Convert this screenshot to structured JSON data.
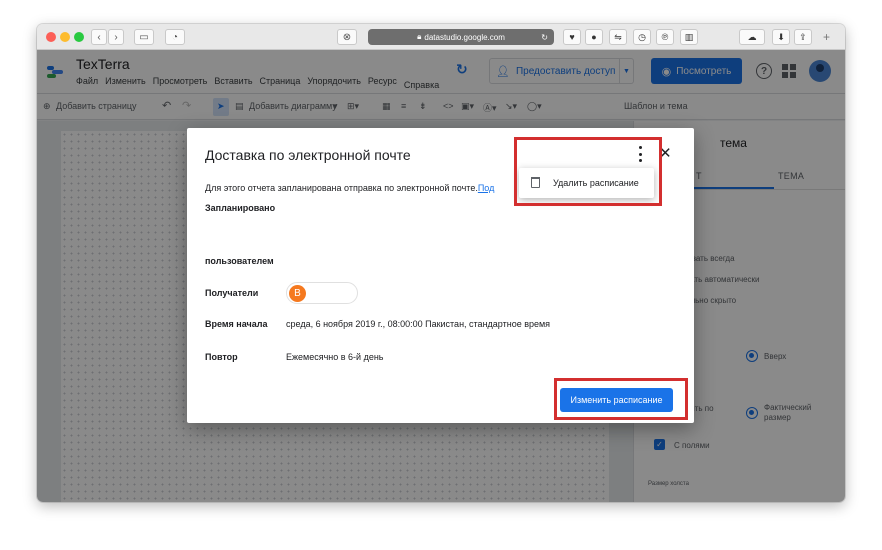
{
  "browser": {
    "url": "datastudio.google.com"
  },
  "app": {
    "title": "TexTerra",
    "menu": [
      "Файл",
      "Изменить",
      "Просмотреть",
      "Вставить",
      "Страница",
      "Упорядочить",
      "Ресурс",
      "Справка"
    ],
    "share_label": "Предоставить доступ",
    "view_label": "Посмотреть"
  },
  "toolbar": {
    "add_page": "Добавить страницу",
    "add_chart": "Добавить диаграмму",
    "template_theme": "Шаблон и тема"
  },
  "panel": {
    "title": "тема",
    "tab_data": "Т",
    "tab_theme": "ТЕМА",
    "items": {
      "always_show": "ывать всегда",
      "auto_show": "вать автоматически",
      "hidden": "ально скрыто",
      "top": "Вверх",
      "fit_a": "нять по",
      "fit_b": "е",
      "actual_size_a": "Фактический",
      "actual_size_b": "размер",
      "with_margins": "С полями",
      "canvas_size": "Размер холста"
    }
  },
  "dialog": {
    "title": "Доставка по электронной почте",
    "description": "Для этого отчета запланирована отправка по электронной почте.",
    "description_link": "Под",
    "scheduled_label": "Запланировано",
    "by_user_label": "пользователем",
    "recipients_label": "Получатели",
    "recipient_initial": "В",
    "start_time_label": "Время начала",
    "start_time_value": "среда, 6 ноября 2019 г., 08:00:00 Пакистан, стандартное время",
    "repeat_label": "Повтор",
    "repeat_value": "Ежемесячно в 6-й день",
    "edit_button": "Изменить расписание",
    "menu_delete": "Удалить расписание",
    "close_glyph": "✕"
  },
  "colors": {
    "accent": "#1a73e8",
    "highlight": "#d32f2f",
    "avatar_orange": "#f5791f"
  }
}
